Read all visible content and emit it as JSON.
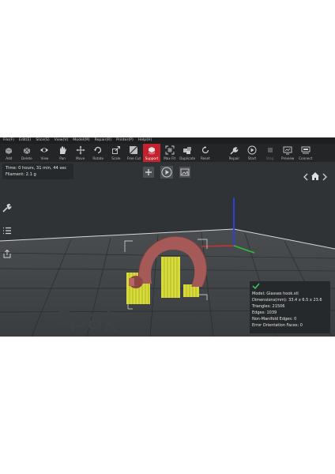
{
  "menu": [
    "File(F)",
    "Edit(E)",
    "Slice(S)",
    "View(V)",
    "Model(M)",
    "Repair(R)",
    "Printer(P)",
    "Help(H)"
  ],
  "toolbar": [
    {
      "label": "Add",
      "icon": "add-model-icon"
    },
    {
      "label": "Delete",
      "icon": "delete-icon"
    },
    {
      "label": "View",
      "icon": "eye-icon"
    },
    {
      "label": "Pan",
      "icon": "hand-icon"
    },
    {
      "label": "Move",
      "icon": "move-icon"
    },
    {
      "label": "Rotate",
      "icon": "rotate-icon"
    },
    {
      "label": "Scale",
      "icon": "scale-icon"
    },
    {
      "label": "Free Cut",
      "icon": "free-cut-icon"
    },
    {
      "label": "Support",
      "icon": "support-icon",
      "active": true
    },
    {
      "label": "Max Fit",
      "icon": "max-fit-icon"
    },
    {
      "label": "Duplicate",
      "icon": "duplicate-icon"
    },
    {
      "label": "Reset",
      "icon": "reset-icon"
    },
    {
      "label": "Repair",
      "icon": "repair-icon"
    },
    {
      "label": "Start",
      "icon": "start-icon"
    },
    {
      "label": "Stop",
      "icon": "stop-icon",
      "disabled": true
    },
    {
      "label": "Preview",
      "icon": "preview-icon"
    },
    {
      "label": "Connect",
      "icon": "connect-icon"
    }
  ],
  "stats": {
    "time": "Time: 0 hours, 31 min, 44 sec",
    "filament": "Filament: 2.1 g"
  },
  "model_info": {
    "model": "Model: Glasses hook.stl",
    "dimensions": "Dimensions(mm): 33.4 x 6.5 x 23.6",
    "triangles": "Triangles: 21506",
    "edges": "Edges: 1039",
    "non_manifold": "Non-Manifold Edges: 0",
    "error_faces": "Error Orientation Faces: 0"
  },
  "colors": {
    "accent": "#c4232d",
    "model": "#a55a58",
    "support": "#d7db3a",
    "check": "#3ec85b"
  }
}
